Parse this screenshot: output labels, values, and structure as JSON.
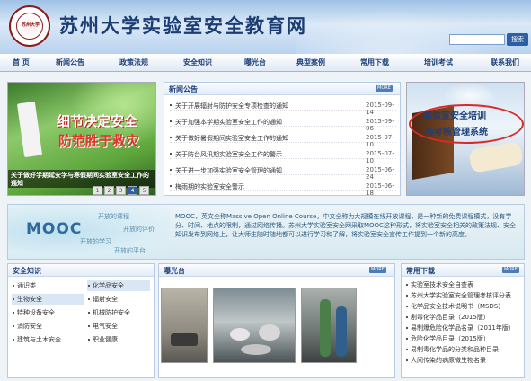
{
  "header": {
    "logo_text": "苏州大学",
    "site_title": "苏州大学实验室安全教育网",
    "search_button": "搜索"
  },
  "nav": [
    "首 页",
    "新闻公告",
    "政策法规",
    "安全知识",
    "曝光台",
    "典型案例",
    "常用下载",
    "培训考试",
    "联系我们"
  ],
  "banner_left": {
    "caption_line1": "细节决定安全",
    "caption_line2": "防范胜于救灾",
    "overlay": "关于做好学期延安学与寒假期间实验室安全工作的通知",
    "pager": [
      "1",
      "2",
      "3",
      "4",
      "5"
    ],
    "active_page": "4"
  },
  "news": {
    "title": "新闻公告",
    "more": "MORE",
    "items": [
      {
        "text": "关于开展辐射与防护安全专项检查的通知",
        "date": "2015-09-14"
      },
      {
        "text": "关于加强本学期实验室安全工作的通知",
        "date": "2015-09-06"
      },
      {
        "text": "关于做好暑假期间实验室安全工作的通知",
        "date": "2015-07-10"
      },
      {
        "text": "关于防台风汛期实验室安全工作的警示",
        "date": "2015-07-10"
      },
      {
        "text": "关于进一步加强实验室安全管理的通知",
        "date": "2015-06-24"
      },
      {
        "text": "梅雨期的实验室安全警示",
        "date": "2015-06-18"
      }
    ]
  },
  "banner_right": {
    "line1": "实验室安全培训",
    "line2": "与考核管理系统"
  },
  "mooc": {
    "logo": "MOOC",
    "tags": [
      "开放的课程",
      "开放的评价",
      "开放的学习",
      "开放的平台"
    ],
    "text": "MOOC，英文全称Massive Open Online Course，中文全称为大规模在线开放课程，是一种新的免费课程模式，没有学分、时间、地点的限制，通过网络传播。苏州大学实验室安全网采取MOOC这种形式，将实验室安全相关的政策法规、安全知识发布到网络上，让大师生随时随地都可以进行学习和了解，将实验室安全宣传工作提到一个新的高度。"
  },
  "knowledge": {
    "title": "安全知识",
    "more": "MORE",
    "col1": [
      "通识类",
      "生物安全",
      "特种设备安全",
      "消防安全",
      "建筑与土木安全"
    ],
    "col2": [
      "化学品安全",
      "辐射安全",
      "机械防护安全",
      "电气安全",
      "职业健康"
    ],
    "highlighted": [
      "生物安全",
      "化学品安全"
    ]
  },
  "exposure": {
    "title": "曝光台",
    "more": "MORE"
  },
  "downloads": {
    "title": "常用下载",
    "more": "MORE",
    "items": [
      "实验室技术安全自查表",
      "苏州大学实验室安全管理考核评分表",
      "化学品安全技术说明书（MSDS）",
      "剧毒化学品目录（2015版）",
      "易制爆危险化学品名录（2011年版）",
      "危险化学品目录（2015版）",
      "易制毒化学品的分类和品种目录",
      "人间传染的病原微生物名录"
    ]
  },
  "colors": {
    "brand_blue": "#1c3f7a",
    "accent_red": "#d92a2a",
    "more_badge": "#4d7cb8"
  }
}
